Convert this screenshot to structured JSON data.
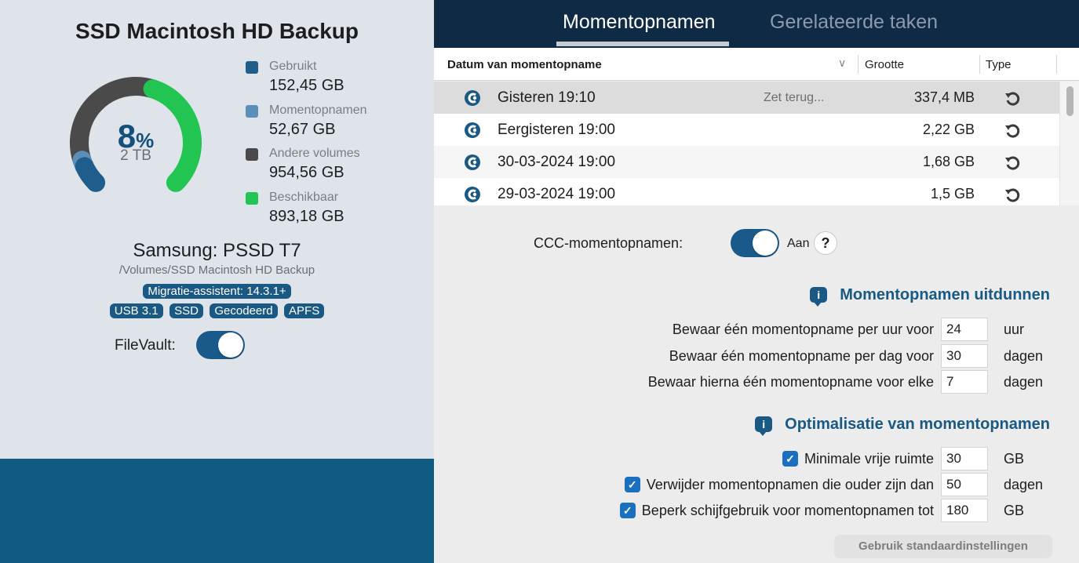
{
  "left": {
    "title": "SSD Macintosh HD Backup",
    "usage_percent": "8",
    "percent_sign": "%",
    "capacity": "2 TB",
    "legend": [
      {
        "label": "Gebruikt",
        "value": "152,45 GB",
        "color": "#1e5d8c"
      },
      {
        "label": "Momentopnamen",
        "value": "52,67 GB",
        "color": "#5b8fb8"
      },
      {
        "label": "Andere volumes",
        "value": "954,56 GB",
        "color": "#4a4a4a"
      },
      {
        "label": "Beschikbaar",
        "value": "893,18 GB",
        "color": "#23c552"
      }
    ],
    "disk_name": "Samsung: PSSD T7",
    "disk_path": "/Volumes/SSD Macintosh HD Backup",
    "migration_tag": "Migratie-assistent: 14.3.1+",
    "tags": [
      "USB 3.1",
      "SSD",
      "Gecodeerd",
      "APFS"
    ],
    "filevault_label": "FileVault:",
    "filevault_on": true
  },
  "tabs": {
    "active": "Momentopnamen",
    "other": "Gerelateerde taken"
  },
  "table": {
    "headers": {
      "date": "Datum van momentopname",
      "size": "Grootte",
      "type": "Type"
    },
    "rows": [
      {
        "date": "Gisteren 19:10",
        "restore": "Zet terug...",
        "size": "337,4 MB",
        "type_icon": "restore-icon"
      },
      {
        "date": "Eergisteren 19:00",
        "restore": "",
        "size": "2,22 GB",
        "type_icon": "restore-icon"
      },
      {
        "date": "30-03-2024 19:00",
        "restore": "",
        "size": "1,68 GB",
        "type_icon": "restore-icon"
      },
      {
        "date": "29-03-2024 19:00",
        "restore": "",
        "size": "1,5 GB",
        "type_icon": "restore-icon"
      }
    ]
  },
  "ccc": {
    "label": "CCC-momentopnamen:",
    "state": "Aan",
    "help": "?"
  },
  "thinning": {
    "title": "Momentopnamen uitdunnen",
    "rows": [
      {
        "label": "Bewaar één momentopname per uur voor",
        "value": "24",
        "unit": "uur"
      },
      {
        "label": "Bewaar één momentopname per dag voor",
        "value": "30",
        "unit": "dagen"
      },
      {
        "label": "Bewaar hierna één momentopname voor elke",
        "value": "7",
        "unit": "dagen"
      }
    ]
  },
  "optimization": {
    "title": "Optimalisatie van momentopnamen",
    "rows": [
      {
        "label": "Minimale vrije ruimte",
        "value": "30",
        "unit": "GB",
        "checked": true
      },
      {
        "label": "Verwijder momentopnamen die ouder zijn dan",
        "value": "50",
        "unit": "dagen",
        "checked": true
      },
      {
        "label": "Beperk schijfgebruik voor momentopnamen tot",
        "value": "180",
        "unit": "GB",
        "checked": true
      }
    ]
  },
  "defaults_button": "Gebruik standaardinstellingen"
}
